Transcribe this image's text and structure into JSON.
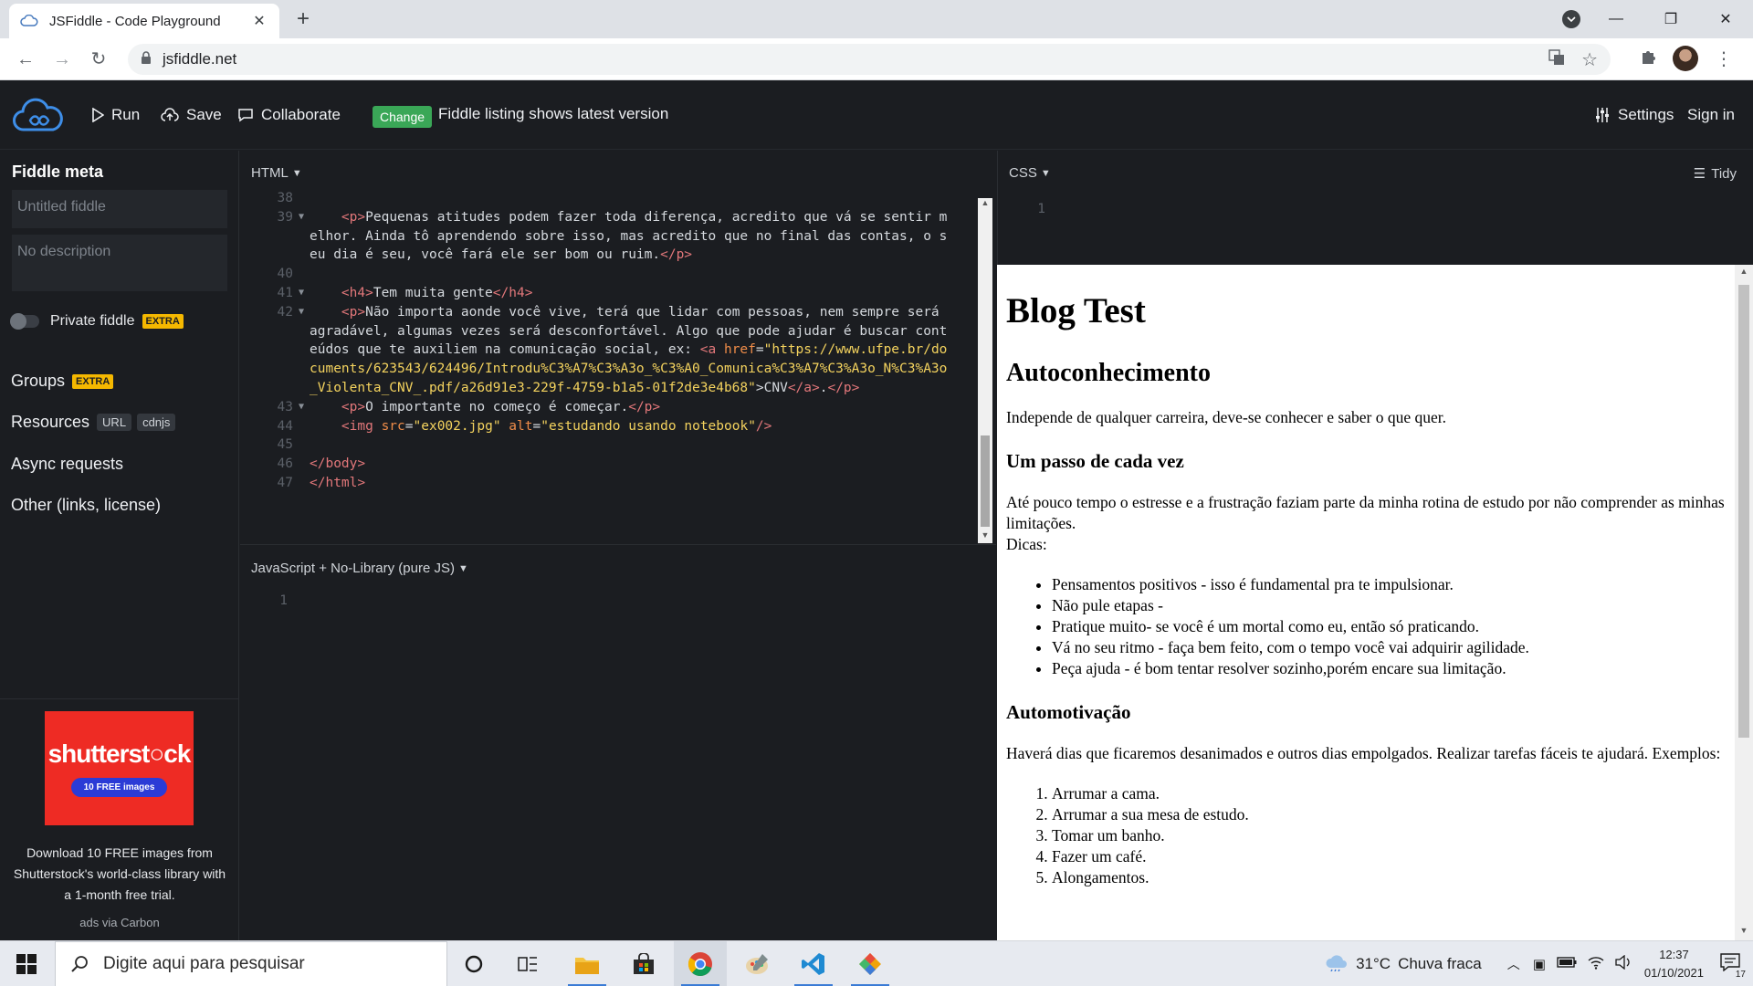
{
  "browser": {
    "tab_title": "JSFiddle - Code Playground",
    "url": "jsfiddle.net"
  },
  "header": {
    "run": "Run",
    "save": "Save",
    "collaborate": "Collaborate",
    "change_badge": "Change",
    "listing_text": "Fiddle listing shows latest version",
    "settings": "Settings",
    "sign_in": "Sign in"
  },
  "sidebar": {
    "meta_title": "Fiddle meta",
    "title_placeholder": "Untitled fiddle",
    "description_placeholder": "No description",
    "private_label": "Private fiddle",
    "extra_badge": "EXTRA",
    "groups": "Groups",
    "resources": "Resources",
    "url_pill": "URL",
    "cdnjs_pill": "cdnjs",
    "async": "Async requests",
    "other": "Other (links, license)"
  },
  "ad": {
    "logo": "shutterst○ck",
    "pill": "10 FREE images",
    "text": "Download 10 FREE images from Shutterstock's world-class library with a 1-month free trial.",
    "via": "ads via Carbon"
  },
  "html_panel": {
    "label": "HTML",
    "lines": {
      "n38": "38",
      "n39": "39",
      "n40": "40",
      "n41": "41",
      "n42": "42",
      "n43": "43",
      "n44": "44",
      "n45": "45",
      "n46": "46",
      "n47": "47",
      "p39": "Pequenas atitudes podem fazer toda diferença, acredito que vá se sentir melhor. Ainda tô aprendendo sobre isso, mas acredito que no final das contas, o seu dia é seu, você fará ele ser bom ou ruim.",
      "h4_41": "Tem muita gente",
      "p42": "Não importa aonde você vive, terá que lidar com pessoas, nem sempre será agradável, algumas vezes será desconfortável. Algo que pode ajudar é buscar conteúdos que te auxiliem na comunicação social, ex: ",
      "href42": "\"https://www.ufpe.br/documents/623543/624496/Introdu%C3%A7%C3%A3o_%C3%A0_Comunica%C3%A7%C3%A3o_N%C3%A3o_Violenta_CNV_.pdf/a26d91e3-229f-4759-b1a5-01f2de3e4b68\"",
      "a42_text": "CNV",
      "p43": "O importante no começo é começar.",
      "img_src": "\"ex002.jpg\"",
      "img_alt": "\"estudando usando notebook\""
    }
  },
  "js_panel": {
    "label": "JavaScript + No-Library (pure JS)",
    "line1": "1"
  },
  "css_panel": {
    "label": "CSS",
    "tidy": "Tidy",
    "line1": "1"
  },
  "result": {
    "h1": "Blog Test",
    "h2": "Autoconhecimento",
    "p1": "Independe de qualquer carreira, deve-se conhecer e saber o que quer.",
    "h4_1": "Um passo de cada vez",
    "p2": "Até pouco tempo o estresse e a frustração faziam parte da minha rotina de estudo por não comprender as minhas limitações.",
    "p2_dicas": "Dicas:",
    "tips": [
      "Pensamentos positivos - isso é fundamental pra te impulsionar.",
      "Não pule etapas -",
      "Pratique muito- se você é um mortal como eu, então só praticando.",
      "Vá no seu ritmo - faça bem feito, com o tempo você vai adquirir agilidade.",
      "Peça ajuda - é bom tentar resolver sozinho,porém encare sua limitação."
    ],
    "h4_2": "Automotivação",
    "p3": "Haverá dias que ficaremos desanimados e outros dias empolgados. Realizar tarefas fáceis te ajudará. Exemplos:",
    "examples": [
      "Arrumar a cama.",
      "Arrumar a sua mesa de estudo.",
      "Tomar um banho.",
      "Fazer um café.",
      "Alongamentos."
    ]
  },
  "taskbar": {
    "search_placeholder": "Digite aqui para pesquisar",
    "temperature": "31°C",
    "weather": "Chuva fraca",
    "time": "12:37",
    "date": "01/10/2021",
    "notifications": "17"
  }
}
